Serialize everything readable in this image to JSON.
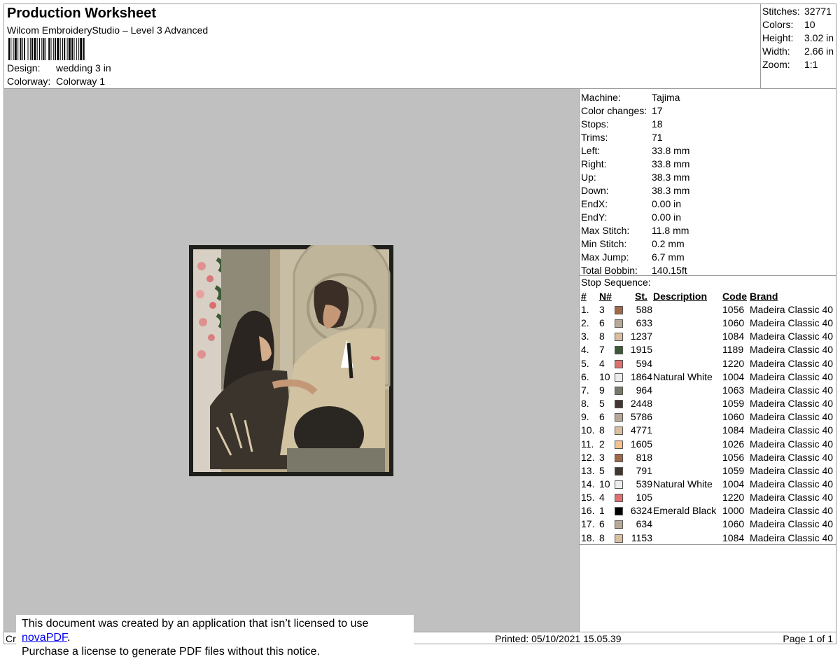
{
  "header": {
    "title": "Production Worksheet",
    "subtitle": "Wilcom EmbroideryStudio – Level 3 Advanced",
    "design_label": "Design:",
    "design_value": "wedding 3 in",
    "colorway_label": "Colorway:",
    "colorway_value": "Colorway 1"
  },
  "summary": [
    {
      "label": "Stitches:",
      "value": "32771"
    },
    {
      "label": "Colors:",
      "value": "10"
    },
    {
      "label": "Height:",
      "value": "3.02 in"
    },
    {
      "label": "Width:",
      "value": "2.66 in"
    },
    {
      "label": "Zoom:",
      "value": "1:1"
    }
  ],
  "machine_info": [
    {
      "label": "Machine:",
      "value": "Tajima"
    },
    {
      "label": "Color changes:",
      "value": "17"
    },
    {
      "label": "Stops:",
      "value": "18"
    },
    {
      "label": "Trims:",
      "value": "71"
    },
    {
      "label": "Left:",
      "value": "33.8 mm"
    },
    {
      "label": "Right:",
      "value": "33.8 mm"
    },
    {
      "label": "Up:",
      "value": "38.3 mm"
    },
    {
      "label": "Down:",
      "value": "38.3 mm"
    },
    {
      "label": "EndX:",
      "value": "0.00 in"
    },
    {
      "label": "EndY:",
      "value": "0.00 in"
    },
    {
      "label": "Max Stitch:",
      "value": "11.8 mm"
    },
    {
      "label": "Min Stitch:",
      "value": "0.2 mm"
    },
    {
      "label": "Max Jump:",
      "value": "6.7 mm"
    },
    {
      "label": "Total Bobbin:",
      "value": "140.15ft"
    }
  ],
  "stop_sequence": {
    "title": "Stop Sequence:",
    "headers": {
      "num": "#",
      "n": "N#",
      "st": "St.",
      "desc": "Description",
      "code": "Code",
      "brand": "Brand"
    },
    "rows": [
      {
        "num": "1.",
        "n": "3",
        "color": "#a0694a",
        "st": "588",
        "desc": "",
        "code": "1056",
        "brand": "Madeira Classic 40"
      },
      {
        "num": "2.",
        "n": "6",
        "color": "#b8a898",
        "st": "633",
        "desc": "",
        "code": "1060",
        "brand": "Madeira Classic 40"
      },
      {
        "num": "3.",
        "n": "8",
        "color": "#d9bea0",
        "st": "1237",
        "desc": "",
        "code": "1084",
        "brand": "Madeira Classic 40"
      },
      {
        "num": "4.",
        "n": "7",
        "color": "#3b5a35",
        "st": "1915",
        "desc": "",
        "code": "1189",
        "brand": "Madeira Classic 40"
      },
      {
        "num": "5.",
        "n": "4",
        "color": "#e07070",
        "st": "594",
        "desc": "",
        "code": "1220",
        "brand": "Madeira Classic 40"
      },
      {
        "num": "6.",
        "n": "10",
        "color": "#ececec",
        "st": "1864",
        "desc": "Natural White",
        "code": "1004",
        "brand": "Madeira Classic 40"
      },
      {
        "num": "7.",
        "n": "9",
        "color": "#7a7868",
        "st": "964",
        "desc": "",
        "code": "1063",
        "brand": "Madeira Classic 40"
      },
      {
        "num": "8.",
        "n": "5",
        "color": "#433530",
        "st": "2448",
        "desc": "",
        "code": "1059",
        "brand": "Madeira Classic 40"
      },
      {
        "num": "9.",
        "n": "6",
        "color": "#b8a898",
        "st": "5786",
        "desc": "",
        "code": "1060",
        "brand": "Madeira Classic 40"
      },
      {
        "num": "10.",
        "n": "8",
        "color": "#d9bea0",
        "st": "4771",
        "desc": "",
        "code": "1084",
        "brand": "Madeira Classic 40"
      },
      {
        "num": "11.",
        "n": "2",
        "color": "#f5bf92",
        "st": "1605",
        "desc": "",
        "code": "1026",
        "brand": "Madeira Classic 40"
      },
      {
        "num": "12.",
        "n": "3",
        "color": "#a0694a",
        "st": "818",
        "desc": "",
        "code": "1056",
        "brand": "Madeira Classic 40"
      },
      {
        "num": "13.",
        "n": "5",
        "color": "#433530",
        "st": "791",
        "desc": "",
        "code": "1059",
        "brand": "Madeira Classic 40"
      },
      {
        "num": "14.",
        "n": "10",
        "color": "#ececec",
        "st": "539",
        "desc": "Natural White",
        "code": "1004",
        "brand": "Madeira Classic 40"
      },
      {
        "num": "15.",
        "n": "4",
        "color": "#e07070",
        "st": "105",
        "desc": "",
        "code": "1220",
        "brand": "Madeira Classic 40"
      },
      {
        "num": "16.",
        "n": "1",
        "color": "#000000",
        "st": "6324",
        "desc": "Emerald Black",
        "code": "1000",
        "brand": "Madeira Classic 40"
      },
      {
        "num": "17.",
        "n": "6",
        "color": "#b8a898",
        "st": "634",
        "desc": "",
        "code": "1060",
        "brand": "Madeira Classic 40"
      },
      {
        "num": "18.",
        "n": "8",
        "color": "#d9bea0",
        "st": "1153",
        "desc": "",
        "code": "1084",
        "brand": "Madeira Classic 40"
      }
    ]
  },
  "footer": {
    "left": "Cr",
    "printed": "Printed: 05/10/2021 15.05.39",
    "page": "Page 1 of 1"
  },
  "notice": {
    "line1_prefix": "This document was created by an application that isn’t licensed to use ",
    "link": "novaPDF",
    "line1_suffix": ".",
    "line2": "Purchase a license to generate PDF files without this notice."
  }
}
